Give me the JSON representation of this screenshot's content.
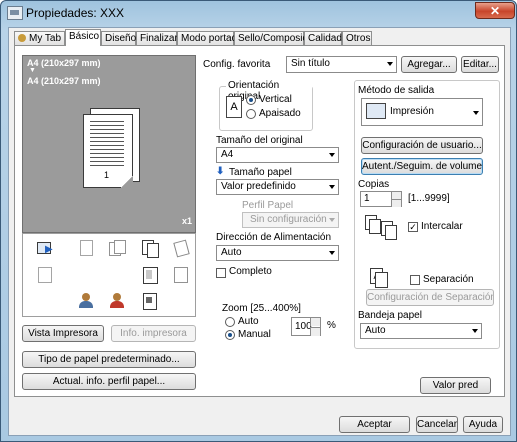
{
  "window": {
    "title": "Propiedades: XXX",
    "close_glyph": "✕"
  },
  "tabs": [
    "My Tab",
    "Básico",
    "Diseño",
    "Finalizar",
    "Modo portada",
    "Sello/Composición",
    "Calidad",
    "Otros"
  ],
  "active_tab": "Básico",
  "preview": {
    "paper_label_1": "A4 (210x297 mm)",
    "arrow": "▼",
    "paper_label_2": "A4 (210x297 mm)",
    "copies_badge": "x1",
    "page_number": "1"
  },
  "left_buttons": {
    "printer_view": "Vista Impresora",
    "printer_info": "Info. impresora",
    "paper_type": "Tipo de papel predeterminado...",
    "update_paper_profile": "Actual. info. perfil papel..."
  },
  "favorite": {
    "label": "Config. favorita",
    "value": "Sin título",
    "add_button": "Agregar...",
    "edit_button": "Editar..."
  },
  "orientation": {
    "group_title": "Orientación original",
    "portrait": "Vertical",
    "landscape": "Apaisado",
    "selected": "Vertical"
  },
  "original_size": {
    "label": "Tamaño del original",
    "value": "A4"
  },
  "paper_size": {
    "label": "Tamaño papel",
    "value": "Valor predefinido"
  },
  "paper_profile": {
    "label": "Perfil Papel",
    "value": "Sin configuración"
  },
  "feed_direction": {
    "label": "Dirección de Alimentación",
    "value": "Auto"
  },
  "complete": {
    "label": "Completo",
    "checked": false
  },
  "zoom": {
    "label": "Zoom [25...400%]",
    "auto": "Auto",
    "manual": "Manual",
    "selected": "Manual",
    "value": "100",
    "unit": "%"
  },
  "output_method": {
    "label": "Método de salida",
    "value": "Impresión"
  },
  "user_settings_button": "Configuración de usuario...",
  "authentication_button": "Autent./Seguim. de volumen...",
  "copies": {
    "label": "Copias",
    "value": "1",
    "range": "[1...9999]"
  },
  "collate": {
    "label": "Intercalar",
    "checked": true
  },
  "separation": {
    "label": "Separación",
    "checked": false,
    "settings_button": "Configuración de Separación..."
  },
  "tray": {
    "label": "Bandeja papel",
    "value": "Auto"
  },
  "default_button": "Valor pred",
  "dialog_buttons": {
    "ok": "Aceptar",
    "cancel": "Cancelar",
    "help": "Ayuda"
  }
}
